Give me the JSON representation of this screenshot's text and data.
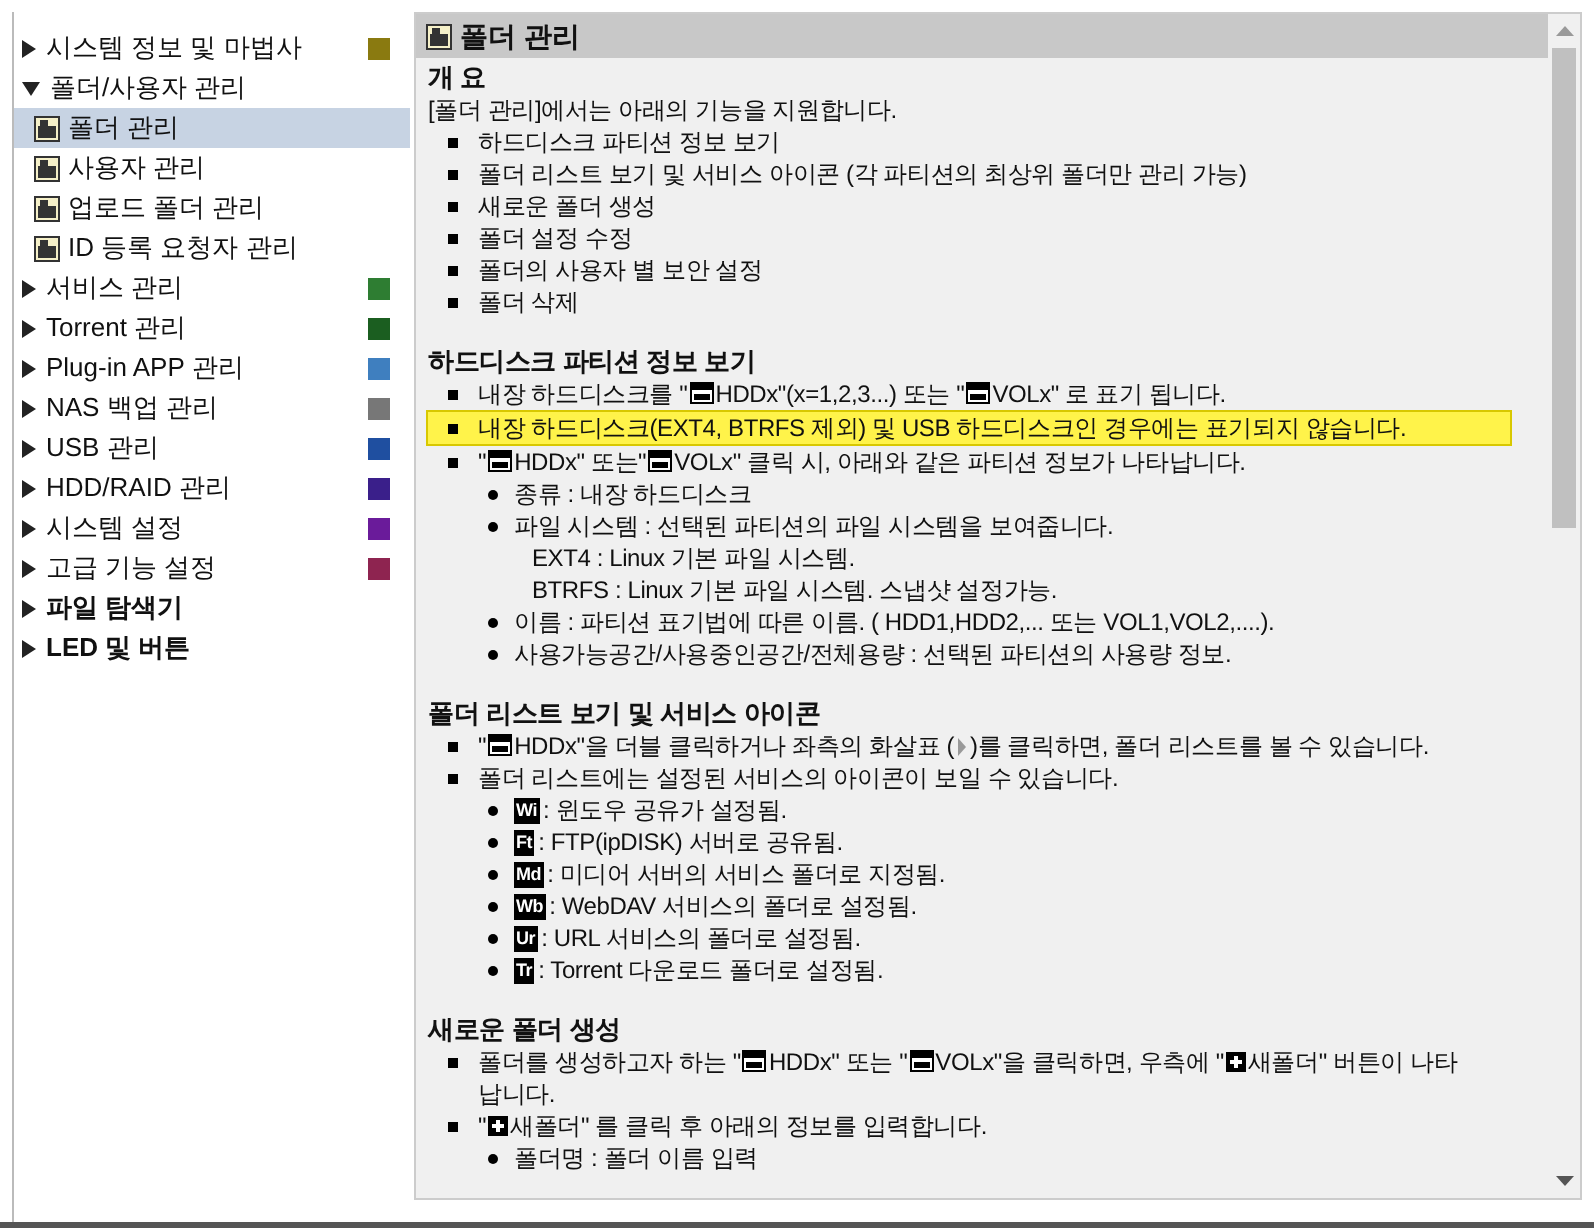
{
  "sidebar": {
    "items": [
      {
        "label": "시스템 정보 및 마법사",
        "expanded": false,
        "bold": false,
        "color": "#8a7a10"
      },
      {
        "label": "폴더/사용자 관리",
        "expanded": true,
        "bold": false,
        "children": [
          {
            "label": "폴더 관리",
            "selected": true
          },
          {
            "label": "사용자 관리",
            "selected": false
          },
          {
            "label": "업로드 폴더 관리",
            "selected": false
          },
          {
            "label": "ID 등록 요청자 관리",
            "selected": false
          }
        ]
      },
      {
        "label": "서비스 관리",
        "expanded": false,
        "bold": false,
        "color": "#2e7d32"
      },
      {
        "label": "Torrent 관리",
        "expanded": false,
        "bold": false,
        "color": "#1b5e20"
      },
      {
        "label": "Plug-in APP 관리",
        "expanded": false,
        "bold": false,
        "color": "#3f7fbf"
      },
      {
        "label": "NAS 백업 관리",
        "expanded": false,
        "bold": false,
        "color": "#777777"
      },
      {
        "label": "USB 관리",
        "expanded": false,
        "bold": false,
        "color": "#1f4fa0"
      },
      {
        "label": "HDD/RAID 관리",
        "expanded": false,
        "bold": false,
        "color": "#3a1f8a"
      },
      {
        "label": "시스템 설정",
        "expanded": false,
        "bold": false,
        "color": "#6a1b9a"
      },
      {
        "label": "고급 기능 설정",
        "expanded": false,
        "bold": false,
        "color": "#8e2450"
      },
      {
        "label": "파일 탐색기",
        "expanded": false,
        "bold": true
      },
      {
        "label": "LED 및 버튼",
        "expanded": false,
        "bold": true
      }
    ]
  },
  "panel": {
    "title": "폴더 관리",
    "sections": [
      {
        "title": "개 요",
        "intro": "[폴더 관리]에서는 아래의 기능을 지원합니다.",
        "items": [
          {
            "highlighted": false,
            "parts": [
              {
                "kind": "text",
                "text": "하드디스크 파티션 정보 보기"
              }
            ]
          },
          {
            "highlighted": false,
            "parts": [
              {
                "kind": "text",
                "text": "폴더 리스트 보기 및 서비스 아이콘 (각 파티션의 최상위 폴더만 관리 가능)"
              }
            ]
          },
          {
            "highlighted": false,
            "parts": [
              {
                "kind": "text",
                "text": "새로운 폴더 생성"
              }
            ]
          },
          {
            "highlighted": false,
            "parts": [
              {
                "kind": "text",
                "text": "폴더 설정 수정"
              }
            ]
          },
          {
            "highlighted": false,
            "parts": [
              {
                "kind": "text",
                "text": "폴더의 사용자 별 보안 설정"
              }
            ]
          },
          {
            "highlighted": false,
            "parts": [
              {
                "kind": "text",
                "text": "폴더 삭제"
              }
            ]
          }
        ]
      },
      {
        "title": "하드디스크 파티션 정보 보기",
        "items": [
          {
            "highlighted": false,
            "parts": [
              {
                "kind": "text",
                "text": "내장 하드디스크를 \""
              },
              {
                "kind": "disk"
              },
              {
                "kind": "text",
                "text": "HDDx\"(x=1,2,3...) 또는 \""
              },
              {
                "kind": "disk"
              },
              {
                "kind": "text",
                "text": "VOLx\" 로 표기 됩니다."
              }
            ]
          },
          {
            "highlighted": true,
            "parts": [
              {
                "kind": "text",
                "text": "내장 하드디스크(EXT4, BTRFS 제외) 및 USB 하드디스크인 경우에는 표기되지 않습니다."
              }
            ]
          },
          {
            "highlighted": false,
            "parts": [
              {
                "kind": "text",
                "text": "\""
              },
              {
                "kind": "disk"
              },
              {
                "kind": "text",
                "text": "HDDx\" 또는\""
              },
              {
                "kind": "disk"
              },
              {
                "kind": "text",
                "text": "VOLx\" 클릭 시, 아래와 같은 파티션 정보가 나타납니다."
              }
            ],
            "children": [
              {
                "parts": [
                  {
                    "kind": "text",
                    "text": "종류 : 내장 하드디스크"
                  }
                ]
              },
              {
                "parts": [
                  {
                    "kind": "text",
                    "text": "파일 시스템 : 선택된 파티션의 파일 시스템을 보여줍니다."
                  }
                ],
                "notes": [
                  "EXT4 : Linux 기본 파일 시스템.",
                  "BTRFS : Linux 기본 파일 시스템. 스냅샷 설정가능."
                ]
              },
              {
                "parts": [
                  {
                    "kind": "text",
                    "text": "이름 : 파티션 표기법에 따른 이름. ( HDD1,HDD2,... 또는 VOL1,VOL2,....)."
                  }
                ]
              },
              {
                "parts": [
                  {
                    "kind": "text",
                    "text": "사용가능공간/사용중인공간/전체용량 : 선택된 파티션의 사용량 정보."
                  }
                ]
              }
            ]
          }
        ]
      },
      {
        "title": "폴더 리스트 보기 및 서비스 아이콘",
        "items": [
          {
            "highlighted": false,
            "parts": [
              {
                "kind": "text",
                "text": "\""
              },
              {
                "kind": "disk"
              },
              {
                "kind": "text",
                "text": "HDDx\"을 더블 클릭하거나 좌측의 화살표 ("
              },
              {
                "kind": "arrow"
              },
              {
                "kind": "text",
                "text": ")를 클릭하면, 폴더 리스트를 볼 수 있습니다."
              }
            ]
          },
          {
            "highlighted": false,
            "parts": [
              {
                "kind": "text",
                "text": "폴더 리스트에는 설정된 서비스의 아이콘이 보일 수 있습니다."
              }
            ],
            "children": [
              {
                "parts": [
                  {
                    "kind": "badge",
                    "text": "Wi"
                  },
                  {
                    "kind": "text",
                    "text": ": 윈도우 공유가 설정됨."
                  }
                ]
              },
              {
                "parts": [
                  {
                    "kind": "badge",
                    "text": "Ft"
                  },
                  {
                    "kind": "text",
                    "text": ": FTP(ipDISK) 서버로 공유됨."
                  }
                ]
              },
              {
                "parts": [
                  {
                    "kind": "badge",
                    "text": "Md"
                  },
                  {
                    "kind": "text",
                    "text": ": 미디어 서버의 서비스 폴더로 지정됨."
                  }
                ]
              },
              {
                "parts": [
                  {
                    "kind": "badge",
                    "text": "Wb"
                  },
                  {
                    "kind": "text",
                    "text": ": WebDAV 서비스의 폴더로 설정됨."
                  }
                ]
              },
              {
                "parts": [
                  {
                    "kind": "badge",
                    "text": "Ur"
                  },
                  {
                    "kind": "text",
                    "text": ": URL 서비스의 폴더로 설정됨."
                  }
                ]
              },
              {
                "parts": [
                  {
                    "kind": "badge",
                    "text": "Tr"
                  },
                  {
                    "kind": "text",
                    "text": ": Torrent 다운로드 폴더로 설정됨."
                  }
                ]
              }
            ]
          }
        ]
      },
      {
        "title": "새로운 폴더 생성",
        "items": [
          {
            "highlighted": false,
            "parts": [
              {
                "kind": "text",
                "text": "폴더를 생성하고자 하는 \""
              },
              {
                "kind": "disk"
              },
              {
                "kind": "text",
                "text": "HDDx\" 또는 \""
              },
              {
                "kind": "disk"
              },
              {
                "kind": "text",
                "text": "VOLx\"을 클릭하면, 우측에 \""
              },
              {
                "kind": "plus"
              },
              {
                "kind": "text",
                "text": "새폴더\" 버튼이 나타"
              },
              {
                "kind": "continuation",
                "text": "납니다."
              }
            ]
          },
          {
            "highlighted": false,
            "parts": [
              {
                "kind": "text",
                "text": "\""
              },
              {
                "kind": "plus"
              },
              {
                "kind": "text",
                "text": "새폴더\" 를 클릭 후 아래의 정보를 입력합니다."
              }
            ],
            "children": [
              {
                "parts": [
                  {
                    "kind": "text",
                    "text": "폴더명 : 폴더 이름 입력"
                  }
                ]
              }
            ]
          }
        ]
      }
    ]
  }
}
